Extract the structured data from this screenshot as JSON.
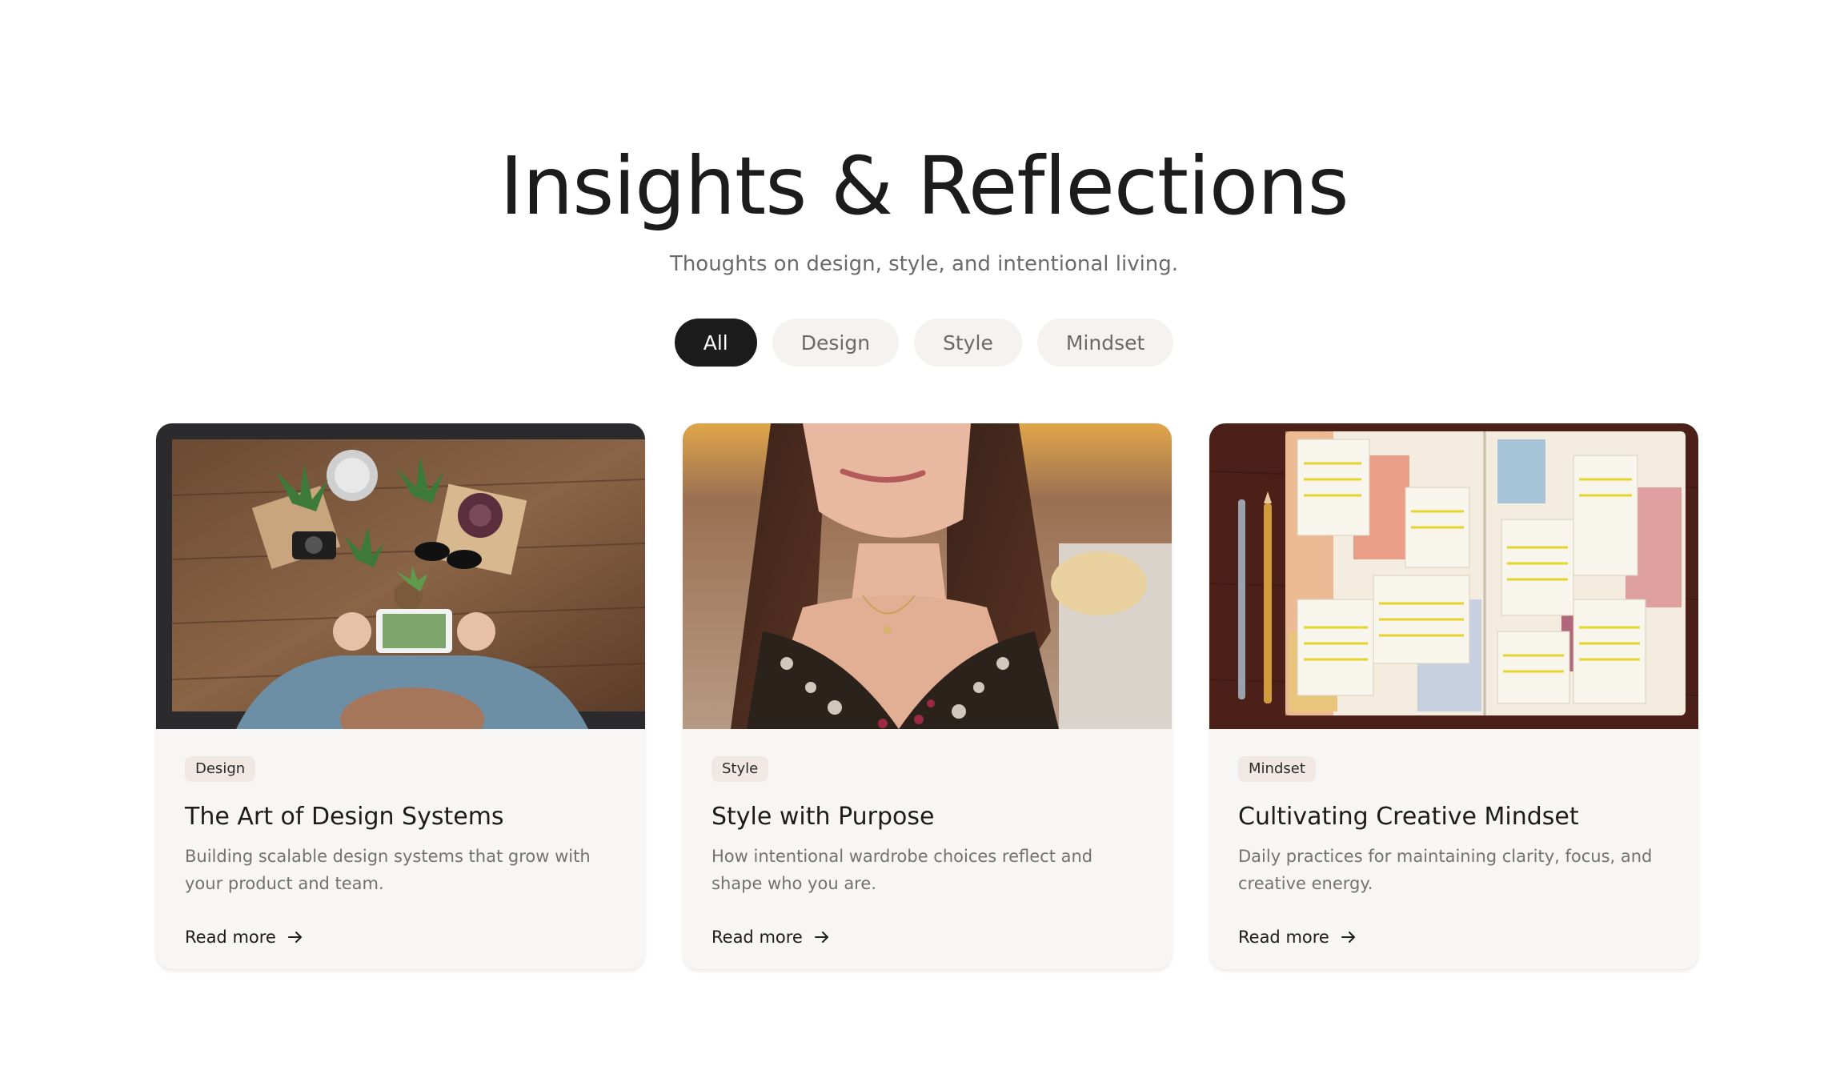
{
  "hero": {
    "title": "Insights & Reflections",
    "subtitle": "Thoughts on design, style, and intentional living."
  },
  "filters": [
    {
      "label": "All",
      "active": true
    },
    {
      "label": "Design",
      "active": false
    },
    {
      "label": "Style",
      "active": false
    },
    {
      "label": "Mindset",
      "active": false
    }
  ],
  "cards": [
    {
      "tag": "Design",
      "title": "The Art of Design Systems",
      "description": "Building scalable design systems that grow with your product and team.",
      "link": "Read more",
      "image": "person-photographing-succulents-on-wooden-table"
    },
    {
      "tag": "Style",
      "title": "Style with Purpose",
      "description": "How intentional wardrobe choices reflect and shape who you are.",
      "link": "Read more",
      "image": "woman-in-floral-dress-smiling"
    },
    {
      "tag": "Mindset",
      "title": "Cultivating Creative Mindset",
      "description": "Daily practices for maintaining clarity, focus, and creative energy.",
      "link": "Read more",
      "image": "weekly-planner-journal-with-pens"
    }
  ],
  "colors": {
    "accent": "#1c1c1c",
    "pill_bg": "#f5f3f1",
    "card_bg": "#f7f6f4",
    "tag_bg": "#f1e8e3",
    "muted_text": "#727272"
  }
}
